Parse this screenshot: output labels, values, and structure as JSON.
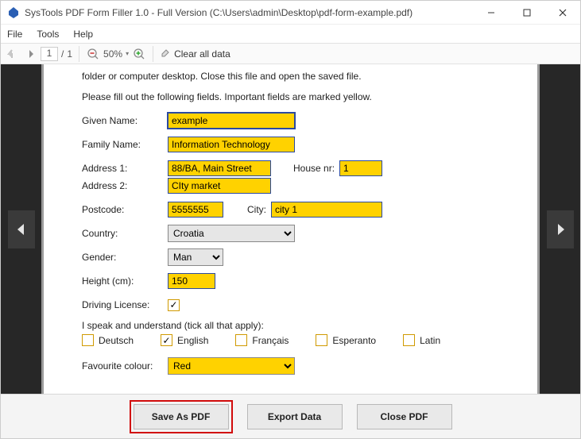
{
  "window": {
    "title": "SysTools PDF Form Filler 1.0 - Full Version (C:\\Users\\admin\\Desktop\\pdf-form-example.pdf)"
  },
  "menu": {
    "file": "File",
    "tools": "Tools",
    "help": "Help"
  },
  "toolbar": {
    "page_current": "1",
    "page_sep": "/",
    "page_total": "1",
    "zoom_value": "50%",
    "clear_label": "Clear all data"
  },
  "page_text": {
    "hint_top": "folder or computer desktop. Close this file and open the saved file.",
    "hint_fill": "Please fill out the following fields. Important fields are marked yellow."
  },
  "labels": {
    "given_name": "Given Name:",
    "family_name": "Family Name:",
    "address1": "Address 1:",
    "address2": "Address 2:",
    "house_nr": "House nr:",
    "postcode": "Postcode:",
    "city": "City:",
    "country": "Country:",
    "gender": "Gender:",
    "height": "Height (cm):",
    "driving": "Driving License:",
    "lang_intro": "I speak and understand (tick all that apply):",
    "fav_colour": "Favourite colour:"
  },
  "values": {
    "given_name": "example",
    "family_name": "Information Technology",
    "address1": "88/BA, Main Street",
    "address2": "CIty market",
    "house_nr": "1",
    "postcode": "5555555",
    "city": "city 1",
    "country": "Croatia",
    "gender": "Man",
    "height": "150",
    "driving_checked": true,
    "fav_colour": "Red"
  },
  "languages": {
    "deutsch": {
      "label": "Deutsch",
      "checked": false
    },
    "english": {
      "label": "English",
      "checked": true
    },
    "francais": {
      "label": "Français",
      "checked": false
    },
    "esperanto": {
      "label": "Esperanto",
      "checked": false
    },
    "latin": {
      "label": "Latin",
      "checked": false
    }
  },
  "buttons": {
    "save_pdf": "Save As PDF",
    "export_data": "Export Data",
    "close_pdf": "Close PDF"
  }
}
